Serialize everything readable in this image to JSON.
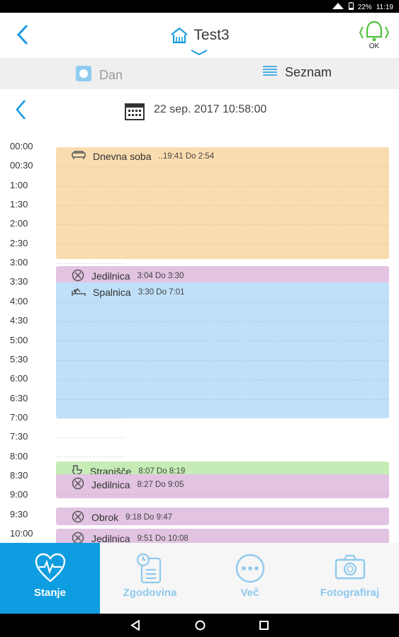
{
  "status_bar": {
    "battery": "22%",
    "time": "11:19"
  },
  "header": {
    "title": "Test3",
    "ok_label": "OK"
  },
  "tabs": [
    {
      "label": "Dan"
    },
    {
      "label": "Seznam"
    }
  ],
  "date": {
    "text": "22 sep. 2017 10:58:00"
  },
  "time_labels": [
    "00:00",
    "00:30",
    "1:00",
    "1:30",
    "2:00",
    "2:30",
    "3:00",
    "3:30",
    "4:00",
    "4:30",
    "5:00",
    "5:30",
    "6:00",
    "6:30",
    "7:00",
    "7:30",
    "8:00",
    "8:30",
    "9:00",
    "9:30",
    "10:00"
  ],
  "events": [
    {
      "room": "Dnevna soba",
      "times": "..19:41 Do 2:54",
      "icon": "sofa-icon",
      "color": "#fbdcb0"
    },
    {
      "room": "Jedilnica",
      "times": "3:04 Do 3:30",
      "icon": "cutlery-icon",
      "color": "#e2c3e2"
    },
    {
      "room": "Spalnica",
      "times": "3:30 Do 7:01",
      "icon": "bed-icon",
      "color": "#bfe0f8"
    },
    {
      "room": "Stranišče",
      "times": "8:07 Do 8:19",
      "icon": "toilet-icon",
      "color": "#c6ecb6"
    },
    {
      "room": "Jedilnica",
      "times": "8:27 Do 9:05",
      "icon": "cutlery-icon",
      "color": "#e2c3e2"
    },
    {
      "room": "Obrok",
      "times": "9:18 Do 9:47",
      "icon": "cutlery-icon",
      "color": "#e2c3e2"
    },
    {
      "room": "Jedilnica",
      "times": "9:51 Do 10:08",
      "icon": "cutlery-icon",
      "color": "#e2c3e2"
    }
  ],
  "bottom_nav": [
    {
      "label": "Stanje",
      "icon": "heart-pulse-icon",
      "active": true
    },
    {
      "label": "Zgodovina",
      "icon": "history-list-icon",
      "active": false
    },
    {
      "label": "Več",
      "icon": "more-dots-icon",
      "active": false
    },
    {
      "label": "Fotografiraj",
      "icon": "camera-icon",
      "active": false
    }
  ],
  "colors": {
    "accent": "#1a9be0",
    "active_tab_bg": "#0d9de0",
    "inactive_nav_text": "#8ec9ee"
  }
}
